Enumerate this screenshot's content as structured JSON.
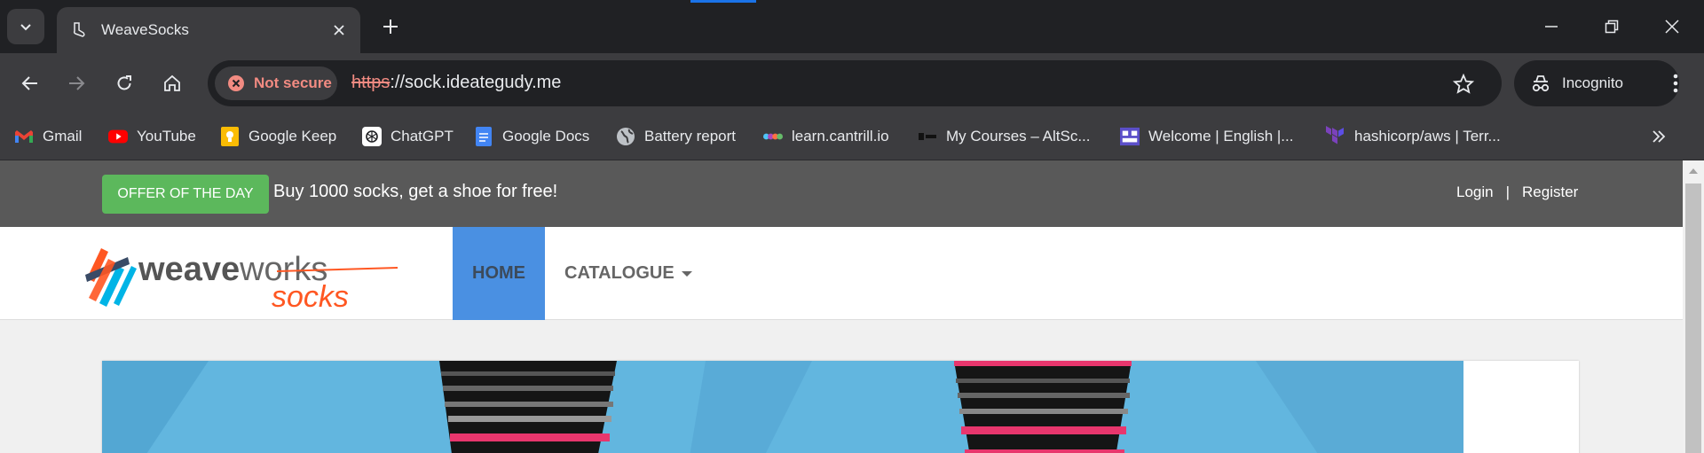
{
  "browser": {
    "tab": {
      "title": "WeaveSocks",
      "favicon": "sock-icon"
    },
    "url": {
      "scheme": "https",
      "rest": "://sock.ideategudy.me"
    },
    "security_label": "Not secure",
    "incognito_label": "Incognito",
    "accent_color": "#1a73e8"
  },
  "bookmarks": [
    {
      "label": "Gmail",
      "icon": "gmail-icon"
    },
    {
      "label": "YouTube",
      "icon": "youtube-icon"
    },
    {
      "label": "Google Keep",
      "icon": "keep-icon"
    },
    {
      "label": "ChatGPT",
      "icon": "chatgpt-icon"
    },
    {
      "label": "Google Docs",
      "icon": "docs-icon"
    },
    {
      "label": "Battery report",
      "icon": "globe-icon"
    },
    {
      "label": "learn.cantrill.io",
      "icon": "cantrill-icon"
    },
    {
      "label": "My Courses – AltSc...",
      "icon": "altschool-icon"
    },
    {
      "label": "Welcome | English |...",
      "icon": "welcome-icon"
    },
    {
      "label": "hashicorp/aws | Terr...",
      "icon": "terraform-icon"
    }
  ],
  "page": {
    "offer_badge": "OFFER OF THE DAY",
    "offer_text": "Buy 1000 socks, get a shoe for free!",
    "login": "Login",
    "separator": "|",
    "register": "Register",
    "logo": {
      "word1": "weave",
      "word2": "works",
      "word3": "socks"
    },
    "nav": {
      "home": "HOME",
      "catalogue": "CATALOGUE"
    },
    "colors": {
      "offer_green": "#5cb85c",
      "nav_active": "#4a90e2",
      "topbar": "#595959"
    }
  }
}
